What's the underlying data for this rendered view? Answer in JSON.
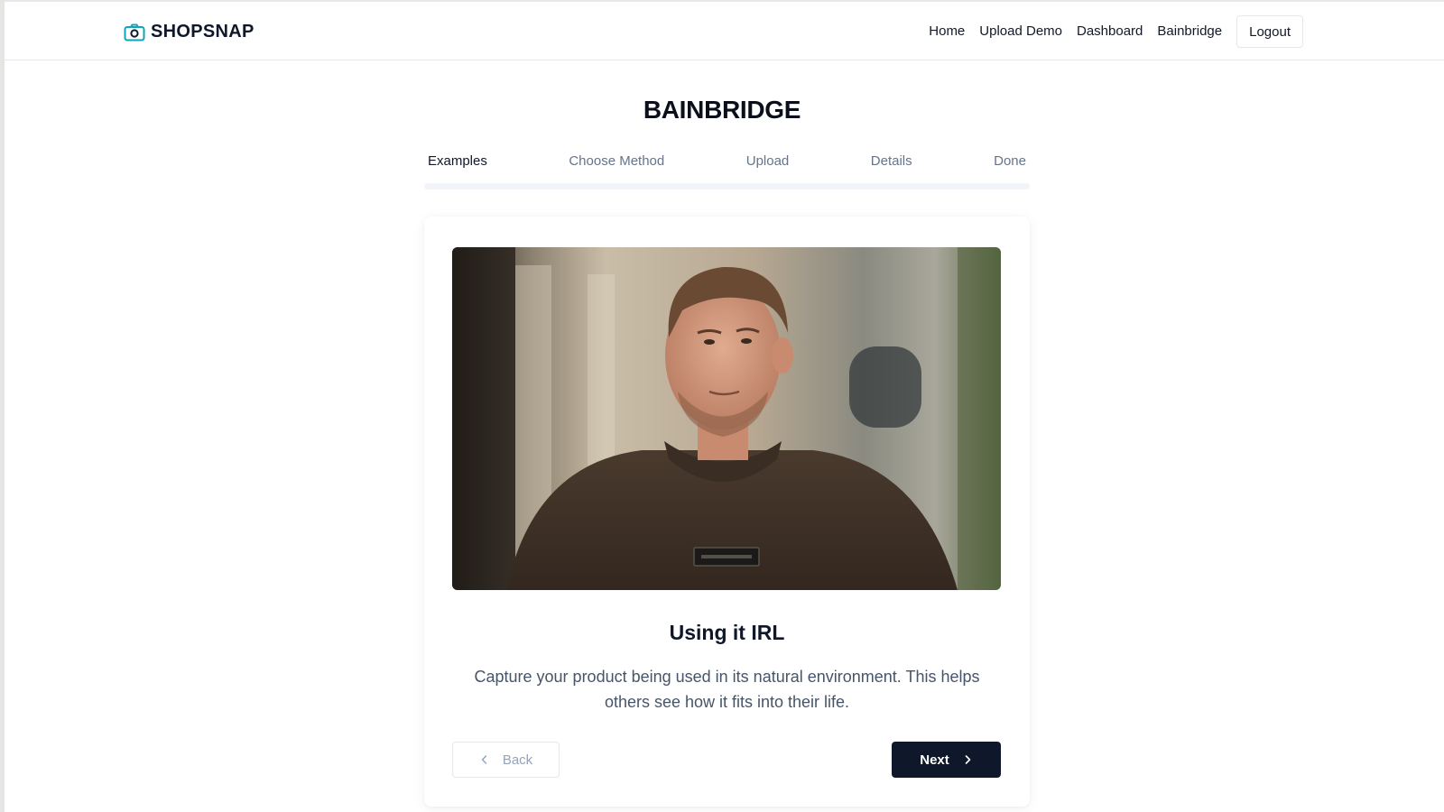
{
  "header": {
    "brand": "SHOPSNAP",
    "brand_icon": "camera-icon",
    "nav": {
      "home": "Home",
      "upload_demo": "Upload Demo",
      "dashboard": "Dashboard",
      "bainbridge": "Bainbridge",
      "logout": "Logout"
    }
  },
  "page": {
    "title": "BAINBRIDGE"
  },
  "steps": {
    "active": "Examples",
    "items": [
      "Examples",
      "Choose Method",
      "Upload",
      "Details",
      "Done"
    ]
  },
  "card": {
    "heading": "Using it IRL",
    "description": "Capture your product being used in its natural environment. This helps others see how it fits into their life.",
    "back_label": "Back",
    "next_label": "Next"
  },
  "colors": {
    "primary": "#0f172a",
    "accent": "#0ea5b7",
    "muted": "#64748b"
  }
}
